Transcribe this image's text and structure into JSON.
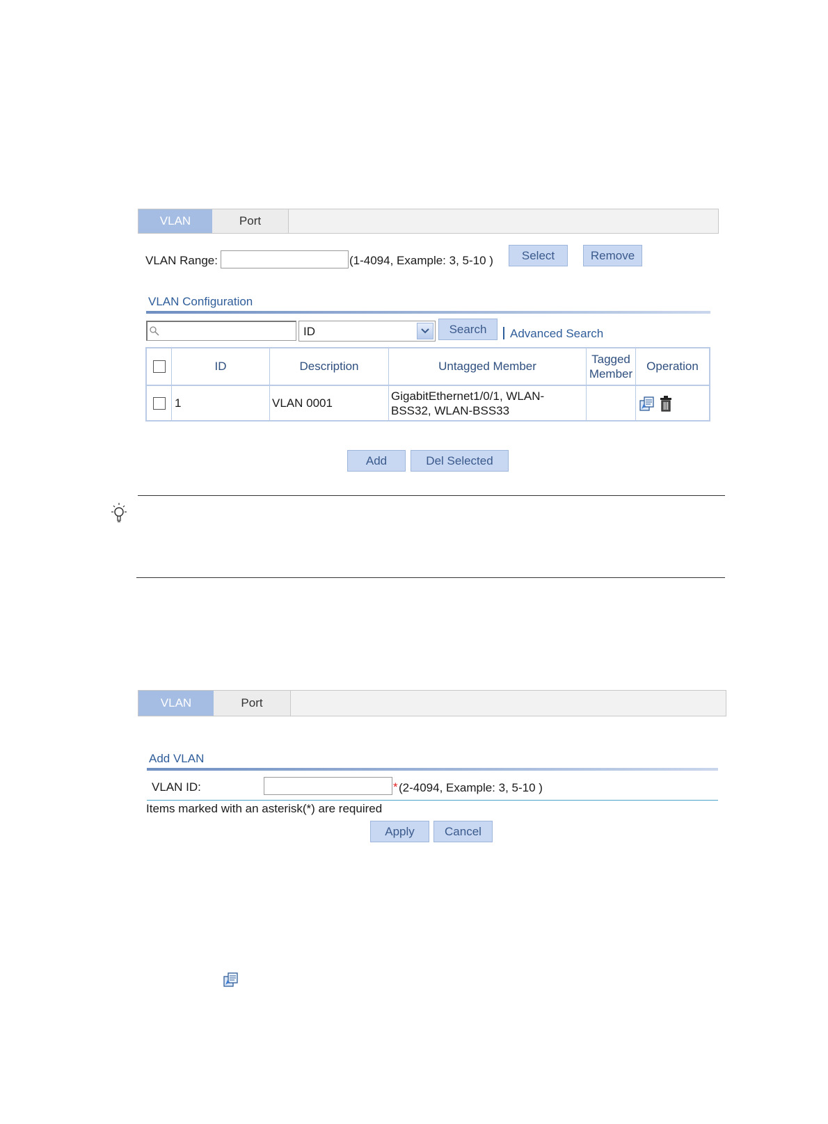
{
  "screen1": {
    "tabs": [
      {
        "label": "VLAN",
        "active": true
      },
      {
        "label": "Port",
        "active": false
      }
    ],
    "vlan_range_label": "VLAN Range:",
    "vlan_range_value": "",
    "vlan_range_hint": "(1-4094, Example: 3, 5-10 )",
    "select_button": "Select",
    "remove_button": "Remove",
    "section_title": "VLAN Configuration",
    "search": {
      "value": "",
      "field_selected": "ID",
      "search_button": "Search",
      "advanced_link": "Advanced Search"
    },
    "table": {
      "headers": [
        "ID",
        "Description",
        "Untagged Member",
        "Tagged Member",
        "Operation"
      ],
      "rows": [
        {
          "id": "1",
          "description": "VLAN 0001",
          "untagged": "GigabitEthernet1/0/1, WLAN-BSS32, WLAN-BSS33",
          "tagged": ""
        }
      ]
    },
    "add_button": "Add",
    "del_selected_button": "Del Selected"
  },
  "screen2": {
    "tabs": [
      {
        "label": "VLAN",
        "active": true
      },
      {
        "label": "Port",
        "active": false
      }
    ],
    "section_title": "Add VLAN",
    "vlan_id_label": "VLAN ID:",
    "vlan_id_value": "",
    "required_mark": "*",
    "vlan_id_hint": "(2-4094, Example: 3, 5-10 )",
    "required_note": "Items marked with an asterisk(*) are required",
    "apply_button": "Apply",
    "cancel_button": "Cancel"
  },
  "colors": {
    "accent": "#2f5d9a",
    "tab_active": "#a6bde3",
    "button_bg": "#c9d8f2",
    "required": "#e02020"
  }
}
